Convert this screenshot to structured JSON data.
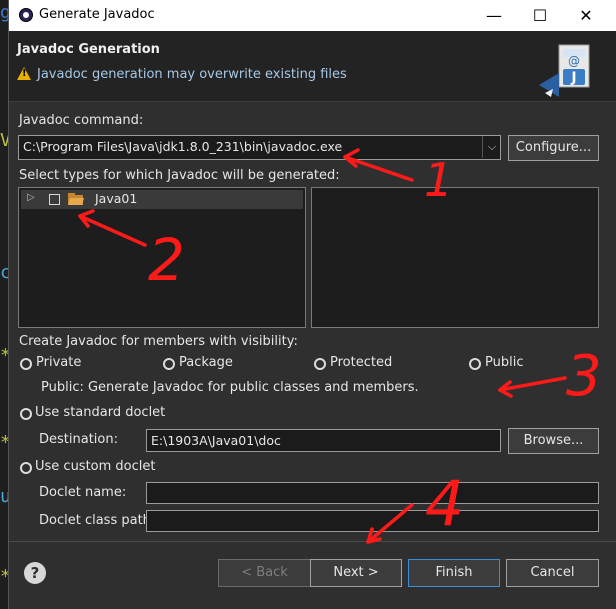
{
  "window": {
    "title": "Generate Javadoc",
    "minimize": "—",
    "maximize": "☐",
    "close": "✕"
  },
  "header": {
    "title": "Javadoc Generation",
    "warning": "Javadoc generation may overwrite existing files"
  },
  "javadoc_command": {
    "label": "Javadoc command:",
    "value": "C:\\Program Files\\Java\\jdk1.8.0_231\\bin\\javadoc.exe",
    "configure": "Configure..."
  },
  "types": {
    "label": "Select types for which Javadoc will be generated:",
    "tree": [
      {
        "name": "Java01",
        "checked": false
      }
    ]
  },
  "visibility": {
    "label": "Create Javadoc for members with visibility:",
    "options": [
      "Private",
      "Package",
      "Protected",
      "Public"
    ],
    "selected": "Public",
    "description": "Public: Generate Javadoc for public classes and members."
  },
  "standard_doclet": {
    "label": "Use standard doclet",
    "selected": true,
    "destination_label": "Destination:",
    "destination": "E:\\1903A\\Java01\\doc",
    "browse": "Browse..."
  },
  "custom_doclet": {
    "label": "Use custom doclet",
    "selected": false,
    "name_label": "Doclet name:",
    "classpath_label": "Doclet class path:"
  },
  "buttons": {
    "back": "< Back",
    "next": "Next >",
    "finish": "Finish",
    "cancel": "Cancel"
  },
  "annotations": [
    "1",
    "2",
    "3",
    "4"
  ],
  "colors": {
    "annotation": "#ff1a1a",
    "accent": "#3a8fd8",
    "warning": "#e8b100"
  }
}
